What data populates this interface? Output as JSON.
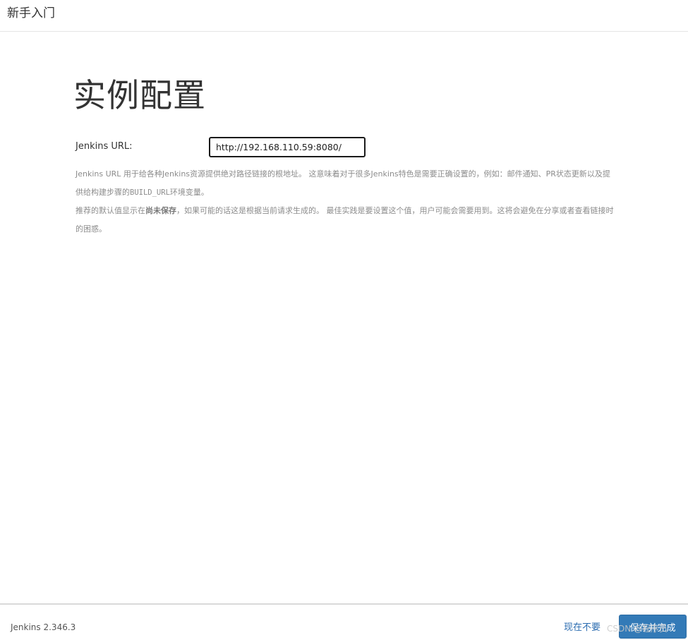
{
  "header": {
    "title": "新手入门"
  },
  "main": {
    "title": "实例配置",
    "url_label": "Jenkins URL:",
    "url_value": "http://192.168.110.59:8080/",
    "help": {
      "p1_a": "Jenkins URL 用于给各种Jenkins资源提供绝对路径链接的根地址。 这意味着对于很多Jenkins特色是需要正确设置的，例如：邮件通知、PR状态更新以及提供给构建步骤的",
      "p1_code": "BUILD_URL",
      "p1_b": "环境变量。",
      "p2_a": "推荐的默认值显示在",
      "p2_strong": "尚未保存",
      "p2_b": "，如果可能的话这是根据当前请求生成的。 最佳实践是要设置这个值，用户可能会需要用到。这将会避免在分享或者查看链接时的困惑。"
    }
  },
  "footer": {
    "version": "Jenkins 2.346.3",
    "skip_label": "现在不要",
    "save_label": "保存并完成",
    "watermark": "CSDN @程序员"
  }
}
